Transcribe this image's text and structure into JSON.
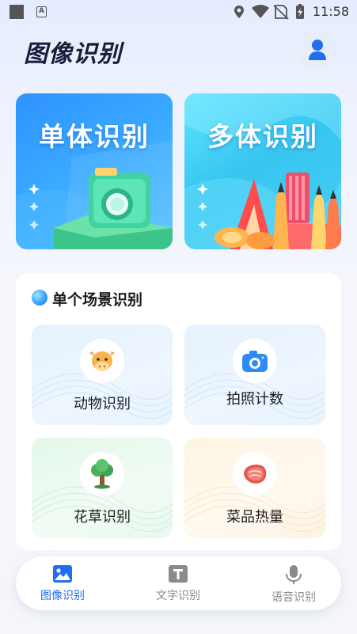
{
  "status_bar": {
    "time": "11:58",
    "notification_icon": "A"
  },
  "header": {
    "title": "图像识别",
    "avatar_icon": "user-icon"
  },
  "banners": [
    {
      "title": "单体识别",
      "icon": "camera-illustration"
    },
    {
      "title": "多体识别",
      "icon": "pencils-illustration"
    }
  ],
  "scene_section": {
    "title": "单个场景识别",
    "items": [
      {
        "label": "动物识别",
        "icon": "cow-icon"
      },
      {
        "label": "拍照计数",
        "icon": "camera-icon"
      },
      {
        "label": "花草识别",
        "icon": "tree-icon"
      },
      {
        "label": "菜品热量",
        "icon": "meat-icon"
      }
    ]
  },
  "bottom_nav": {
    "items": [
      {
        "label": "图像识别",
        "icon": "image-icon",
        "active": true
      },
      {
        "label": "文字识别",
        "icon": "text-icon",
        "active": false
      },
      {
        "label": "语音识别",
        "icon": "microphone-icon",
        "active": false
      }
    ]
  },
  "colors": {
    "accent": "#1f6ff0",
    "title": "#161e3a",
    "inactive": "#8a8a8a"
  }
}
